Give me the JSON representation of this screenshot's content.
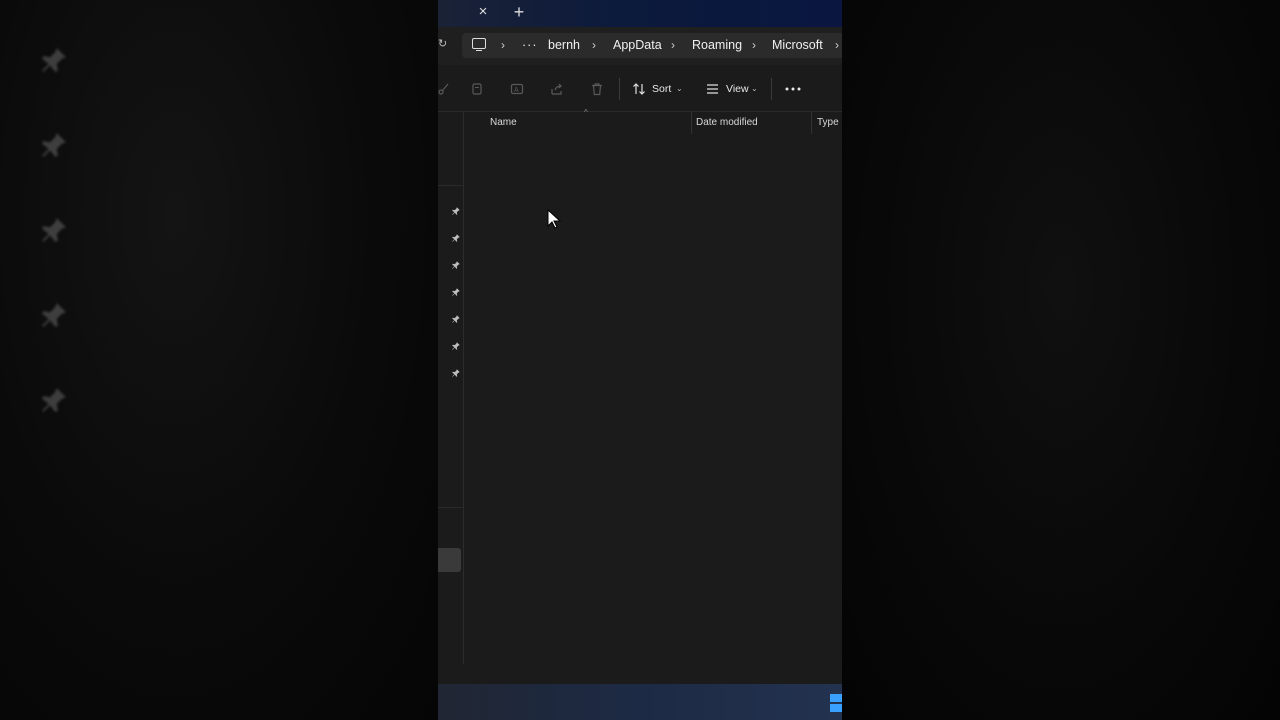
{
  "window": {
    "tabbar": {
      "close_glyph": "×",
      "new_tab_glyph": "+"
    },
    "address": {
      "refresh_glyph": "↻",
      "more_glyph": "···",
      "breadcrumbs": [
        "bernh",
        "AppData",
        "Roaming",
        "Microsoft"
      ],
      "separator_glyph": "›"
    },
    "toolbar": {
      "sort_label": "Sort",
      "view_label": "View",
      "caret_glyph": "⌄",
      "more_icon": "more-options-icon",
      "disabled_icons": [
        "cut-icon",
        "copy-icon",
        "paste-icon",
        "rename-icon",
        "share-icon",
        "delete-icon"
      ]
    },
    "columns": {
      "name": "Name",
      "date_modified": "Date modified",
      "type": "Type"
    },
    "nav_pins_count": 7
  },
  "colors": {
    "window_bg": "#1b1b1b",
    "tab_bar": "#0c1a3c",
    "address_field": "#2b2b2b",
    "taskbar": "#1d2a45",
    "start_accent": "#3aa0ff"
  }
}
